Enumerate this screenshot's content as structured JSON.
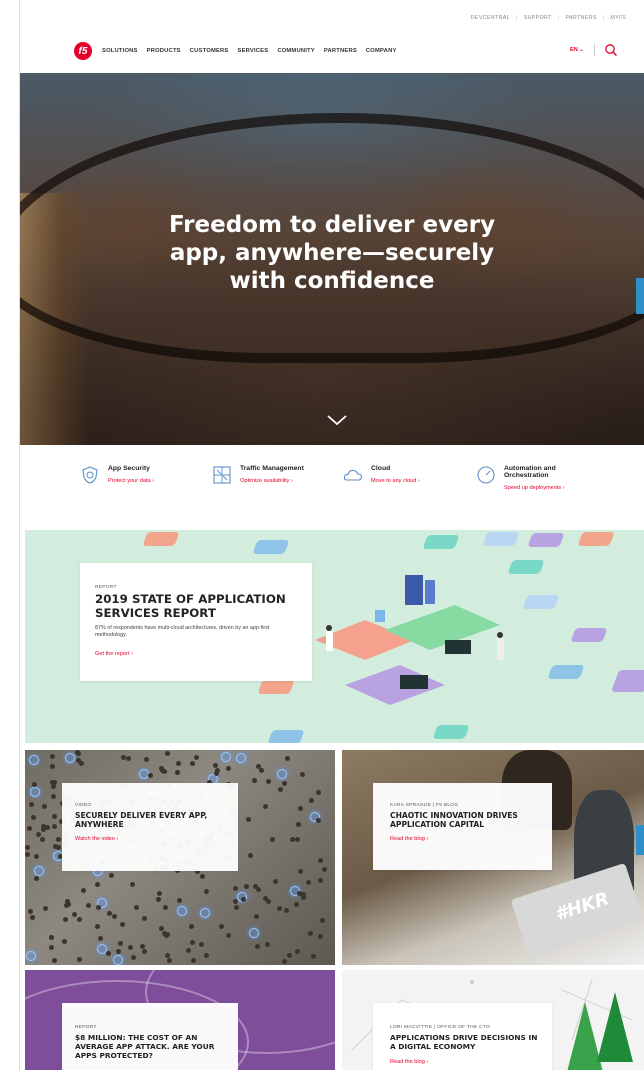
{
  "utility_nav": [
    "DEVCENTRAL",
    "SUPPORT",
    "PARTNERS",
    "MYF5"
  ],
  "utility_sep": "|",
  "logo_text": "f5",
  "main_nav": [
    "SOLUTIONS",
    "PRODUCTS",
    "CUSTOMERS",
    "SERVICES",
    "COMMUNITY",
    "PARTNERS",
    "COMPANY"
  ],
  "language": "EN ⌄",
  "icons": {
    "search": "search-icon",
    "chevron": "chevron-down-icon"
  },
  "hero": {
    "headline": "Freedom to deliver every app, anywhere—securely with confidence"
  },
  "categories": [
    {
      "title": "App Security",
      "link": "Protect your data ›",
      "icon": "shield-icon"
    },
    {
      "title": "Traffic Management",
      "link": "Optimize availability ›",
      "icon": "traffic-icon"
    },
    {
      "title": "Cloud",
      "link": "Move to any cloud ›",
      "icon": "cloud-icon"
    },
    {
      "title": "Automation and Orchestration",
      "link": "Speed up deployments ›",
      "icon": "gauge-icon"
    }
  ],
  "report": {
    "eyebrow": "REPORT",
    "title": "2019 STATE OF APPLICATION SERVICES REPORT",
    "body": "87% of respondents have multi-cloud architectures, driven by an app-first methodology.",
    "cta": "Get the report ›"
  },
  "tiles": [
    {
      "eyebrow": "VIDEO",
      "title": "SECURELY DELIVER EVERY APP, ANYWHERE",
      "cta": "Watch the video ›"
    },
    {
      "eyebrow": "KARA SPRAGUE | F5 BLOG",
      "title": "CHAOTIC INNOVATION DRIVES APPLICATION CAPITAL",
      "cta": "Read the blog ›"
    },
    {
      "eyebrow": "REPORT",
      "title": "$8 MILLION: THE COST OF AN AVERAGE APP ATTACK. ARE YOUR APPS PROTECTED?",
      "cta": ""
    },
    {
      "eyebrow": "LORI MACVITTIE | OFFICE OF THE CTO",
      "title": "APPLICATIONS DRIVE DECISIONS IN A DIGITAL ECONOMY",
      "cta": "Read the blog ›"
    }
  ],
  "laptop_sticker": "#HKR",
  "colors": {
    "brand": "#e4002b",
    "report_bg": "#d2ecdd",
    "accent_blue": "#2f8fc8"
  }
}
